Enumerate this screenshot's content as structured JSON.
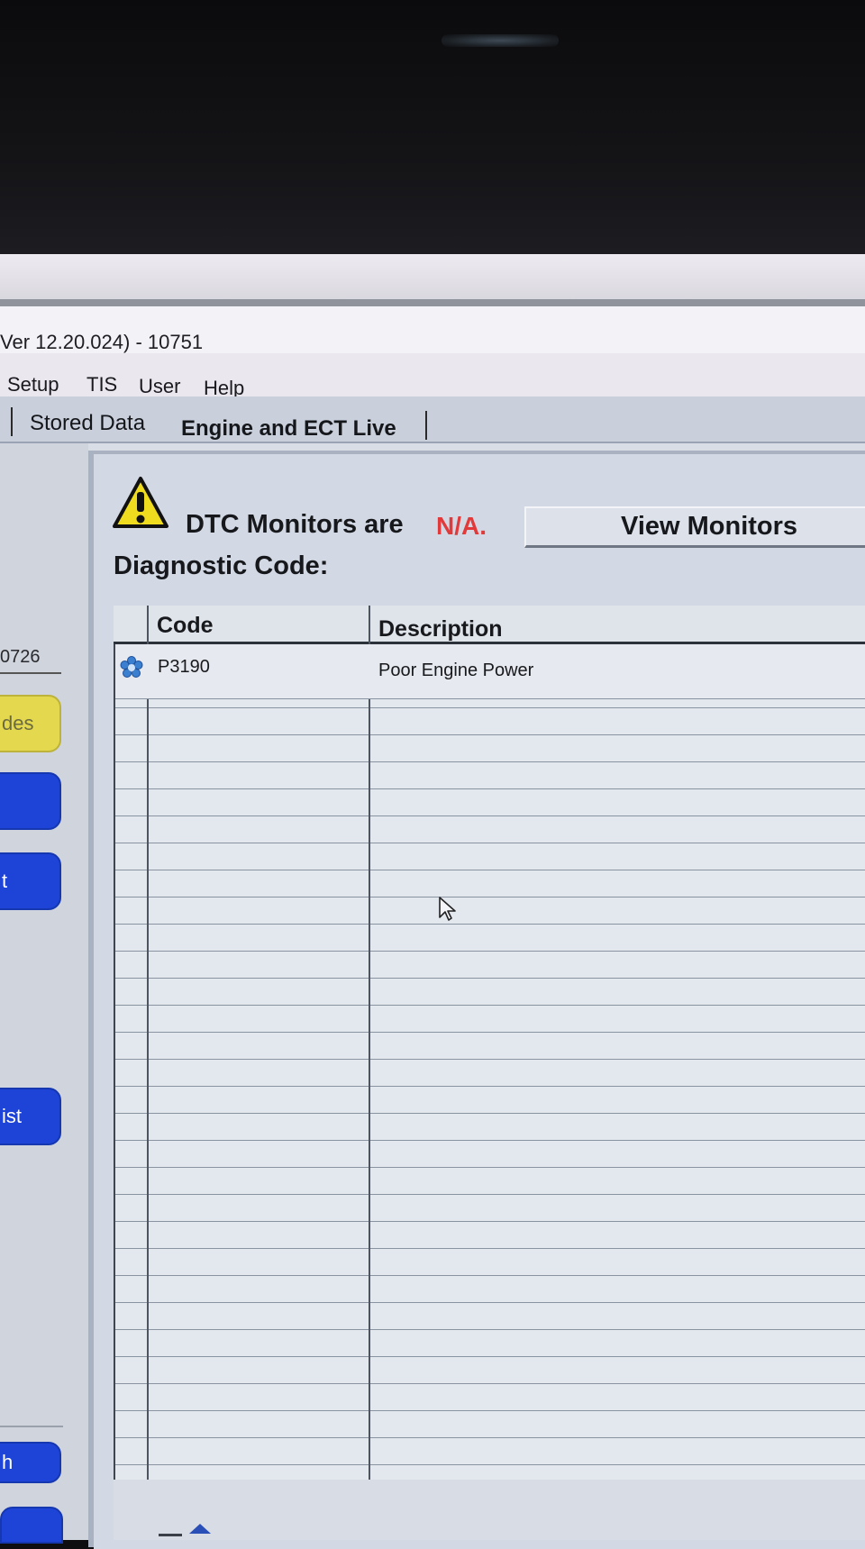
{
  "window": {
    "title": "Ver 12.20.024) - 10751"
  },
  "menu": {
    "items": [
      "Setup",
      "TIS",
      "User",
      "Help"
    ]
  },
  "tabs": [
    "Stored Data",
    "Engine and ECT Live"
  ],
  "sidebar": {
    "value": "0726",
    "buttons": [
      "des",
      "",
      "t",
      "ist",
      "h"
    ]
  },
  "dtc_status": {
    "prefix": "DTC Monitors are",
    "status": "N/A.",
    "view_button": "View Monitors"
  },
  "diagnostic_label": "Diagnostic Code:",
  "table": {
    "columns": [
      "Code",
      "Description"
    ],
    "rows": [
      {
        "code": "P3190",
        "description": "Poor Engine Power"
      }
    ]
  },
  "colors": {
    "accent_blue": "#1d44d6",
    "accent_yellow": "#e4d94e",
    "status_red": "#e23a3a"
  },
  "icons": [
    "warning-icon",
    "dtc-status-icon",
    "mouse-cursor-icon"
  ]
}
